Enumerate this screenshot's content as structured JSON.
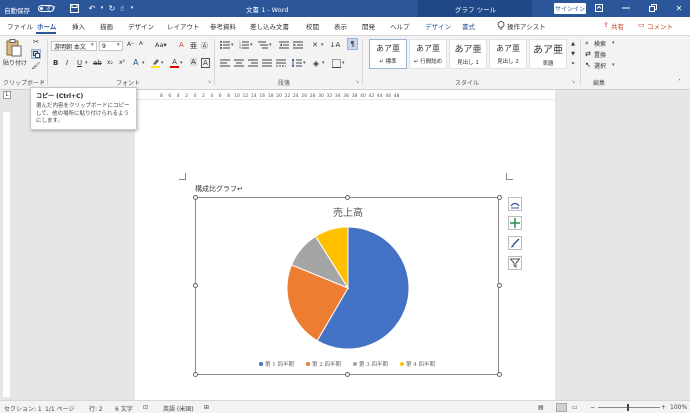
{
  "titlebar": {
    "autosave_label": "自動保存",
    "autosave_state": "オフ",
    "doc_title": "文書 1  -  Word",
    "context_tool": "グラフ ツール",
    "signin_label": "サインイン"
  },
  "tabs": [
    {
      "label": "ファイル",
      "active": false
    },
    {
      "label": "ホーム",
      "active": true
    },
    {
      "label": "挿入",
      "active": false
    },
    {
      "label": "描画",
      "active": false
    },
    {
      "label": "デザイン",
      "active": false
    },
    {
      "label": "レイアウト",
      "active": false
    },
    {
      "label": "参考資料",
      "active": false
    },
    {
      "label": "差し込み文書",
      "active": false
    },
    {
      "label": "校閲",
      "active": false
    },
    {
      "label": "表示",
      "active": false
    },
    {
      "label": "開発",
      "active": false
    },
    {
      "label": "ヘルプ",
      "active": false
    },
    {
      "label": "デザイン",
      "active": false,
      "contextual": true
    },
    {
      "label": "書式",
      "active": false,
      "contextual": true
    }
  ],
  "tell_me": "操作アシスト",
  "share_label": "共有",
  "comment_label": "コメント",
  "ribbon": {
    "paste_label": "貼り付け",
    "clipboard_group": "クリップボード",
    "font_name": "游明朝 本文",
    "font_size": "9",
    "font_group": "フォント",
    "paragraph_group": "段落",
    "style_group": "スタイル",
    "edit_group": "編集",
    "styles": [
      {
        "sample": "あア亜",
        "name": "↵ 標準"
      },
      {
        "sample": "あア亜",
        "name": "↵ 行間詰め"
      },
      {
        "sample": "あア亜",
        "name": "見出し 1"
      },
      {
        "sample": "あア亜",
        "name": "見出し 2"
      },
      {
        "sample": "あア亜",
        "name": "表題"
      }
    ],
    "find_label": "検索",
    "replace_label": "置換",
    "select_label": "選択"
  },
  "tooltip": {
    "title": "コピー (Ctrl+C)",
    "body": "選んだ内容をクリップボードにコピーして、他の場所に貼り付けられるようにします。"
  },
  "document": {
    "heading": "構成比グラフ↵"
  },
  "chart_data": {
    "type": "pie",
    "title": "売上高",
    "categories": [
      "第 1 四半期",
      "第 2 四半期",
      "第 3 四半期",
      "第 4 四半期"
    ],
    "values": [
      59,
      23,
      10,
      9
    ],
    "colors": [
      "#4472c4",
      "#ed7d31",
      "#a5a5a5",
      "#ffc000"
    ],
    "legend_position": "bottom"
  },
  "statusbar": {
    "section": "セクション: 1",
    "pages": "1/1 ページ",
    "line": "行: 2",
    "chars": "6 文字",
    "language": "英語 (米国)",
    "zoom": "100%"
  }
}
